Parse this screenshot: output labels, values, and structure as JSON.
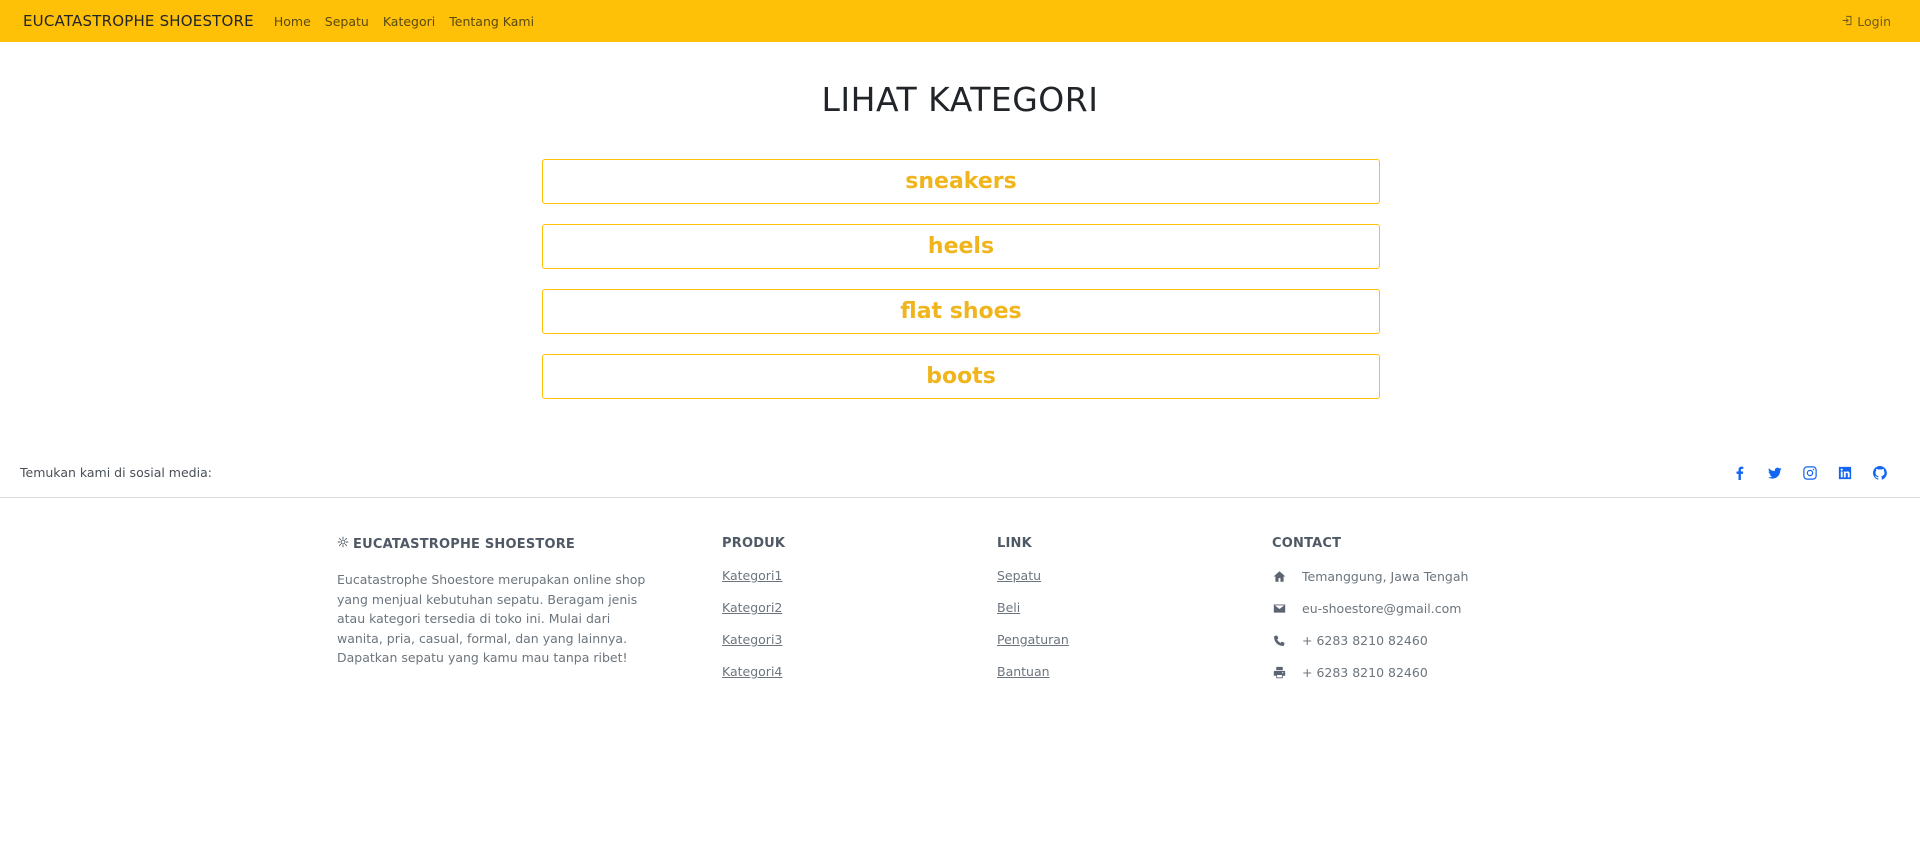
{
  "navbar": {
    "brand": "EUCATASTROPHE SHOESTORE",
    "links": [
      "Home",
      "Sepatu",
      "Kategori",
      "Tentang Kami"
    ],
    "login_label": "Login"
  },
  "main": {
    "title": "LIHAT KATEGORI",
    "categories": [
      "sneakers",
      "heels",
      "flat shoes",
      "boots"
    ]
  },
  "social": {
    "text": "Temukan kami di sosial media:",
    "icons": [
      "facebook-icon",
      "twitter-icon",
      "instagram-icon",
      "linkedin-icon",
      "github-icon"
    ]
  },
  "footer": {
    "about": {
      "title": "EUCATASTROPHE SHOESTORE",
      "text": "Eucatastrophe Shoestore merupakan online shop yang menjual kebutuhan sepatu. Beragam jenis atau kategori tersedia di toko ini. Mulai dari wanita, pria, casual, formal, dan yang lainnya. Dapatkan sepatu yang kamu mau tanpa ribet!"
    },
    "produk": {
      "title": "PRODUK",
      "links": [
        "Kategori1",
        "Kategori2",
        "Kategori3",
        "Kategori4"
      ]
    },
    "link": {
      "title": "LINK",
      "links": [
        "Sepatu",
        "Beli",
        "Pengaturan",
        "Bantuan"
      ]
    },
    "contact": {
      "title": "CONTACT",
      "address": "Temanggung, Jawa Tengah",
      "email": "eu-shoestore@gmail.com",
      "phone": "+ 6283 8210 82460",
      "fax": "+ 6283 8210 82460"
    }
  },
  "colors": {
    "navbar": "#ffc107",
    "accent_text": "#f0b51c",
    "social_icon": "#1266f1"
  }
}
